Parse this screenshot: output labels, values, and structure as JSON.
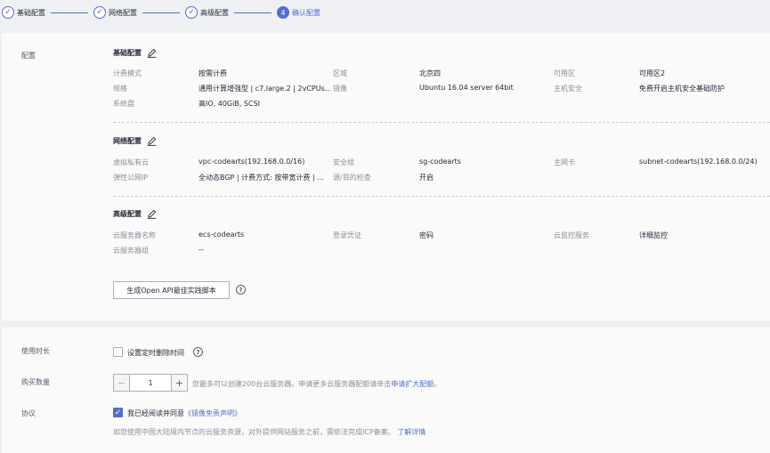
{
  "steps": [
    {
      "label": "基础配置",
      "icon": "✓"
    },
    {
      "label": "网络配置",
      "icon": "✓"
    },
    {
      "label": "高级配置",
      "icon": "✓"
    },
    {
      "label": "确认配置",
      "icon": "4"
    }
  ],
  "config": {
    "side_label": "配置",
    "basic": {
      "title": "基础配置",
      "rows": [
        [
          "计费模式",
          "按需计费",
          "区域",
          "北京四",
          "可用区",
          "可用区2"
        ],
        [
          "规格",
          "通用计算增强型 | c7.large.2 | 2vCPUs...",
          "镜像",
          "Ubuntu 16.04 server 64bit",
          "主机安全",
          "免费开启主机安全基础防护"
        ],
        [
          "系统盘",
          "高IO, 40GiB, SCSI",
          "",
          "",
          "",
          ""
        ]
      ]
    },
    "network": {
      "title": "网络配置",
      "rows": [
        [
          "虚拟私有云",
          "vpc-codearts(192.168.0.0/16)",
          "安全组",
          "sg-codearts",
          "主网卡",
          "subnet-codearts(192.168.0.0/24)"
        ],
        [
          "弹性公网IP",
          "全动态BGP | 计费方式: 按带宽计费 | ...",
          "源/目的检查",
          "开启",
          "",
          ""
        ]
      ]
    },
    "advanced": {
      "title": "高级配置",
      "rows": [
        [
          "云服务器名称",
          "ecs-codearts",
          "登录凭证",
          "密码",
          "云监控服务",
          "详细监控"
        ],
        [
          "云服务器组",
          "--",
          "",
          "",
          "",
          ""
        ]
      ]
    },
    "api_button": "生成Open API最佳实践脚本"
  },
  "purchase": {
    "duration_label": "使用时长",
    "auto_delete_label": "设置定时删除时间",
    "quantity_label": "购买数量",
    "quantity_value": "1",
    "quantity_hint": "您最多可以创建200台云服务器。申请更多云服务器配额请单击",
    "quantity_link": "申请扩大配额",
    "quantity_hint_end": "。",
    "agreement_label": "协议",
    "agreement_text": "我已经阅读并同意",
    "agreement_link": "《镜像免责声明》",
    "icp_note": "如您使用中国大陆境内节点的云服务资源，对外提供网站服务之前，需依法完成ICP备案。",
    "icp_link": "了解详情"
  }
}
